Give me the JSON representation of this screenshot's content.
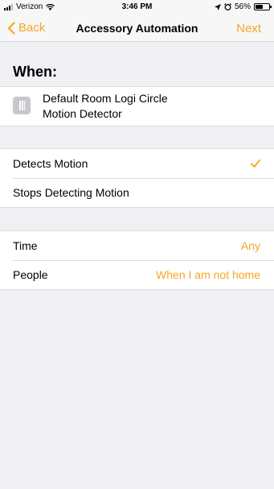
{
  "status_bar": {
    "carrier": "Verizon",
    "time": "3:46 PM",
    "battery": "56%",
    "battery_level": 0.56
  },
  "nav": {
    "back_label": "Back",
    "title": "Accessory Automation",
    "next_label": "Next"
  },
  "when": {
    "header": "When:",
    "accessory_line1": "Default Room Logi Circle",
    "accessory_line2": "Motion Detector"
  },
  "triggers": {
    "items": [
      {
        "label": "Detects Motion",
        "selected": true
      },
      {
        "label": "Stops Detecting Motion",
        "selected": false
      }
    ]
  },
  "conditions": {
    "time_label": "Time",
    "time_value": "Any",
    "people_label": "People",
    "people_value": "When I am not home"
  },
  "colors": {
    "accent": "#f5a623",
    "background": "#efeff4"
  }
}
